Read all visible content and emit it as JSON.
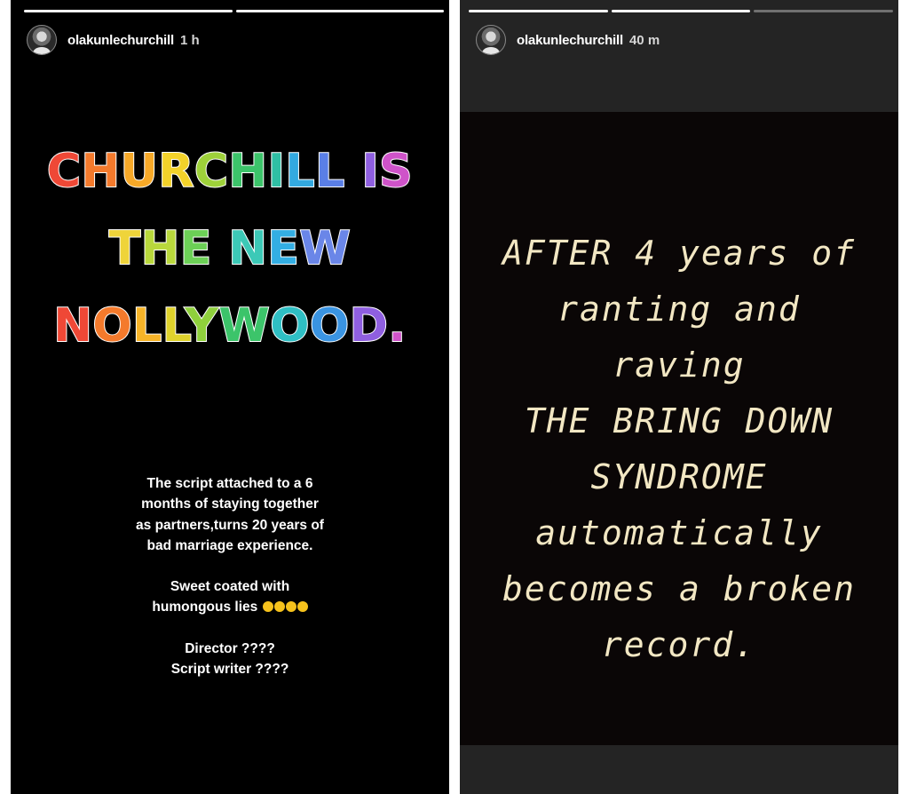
{
  "stories": [
    {
      "user": {
        "username": "olakunlechurchill",
        "time": "1 h"
      },
      "headline_lines": [
        {
          "chars": [
            {
              "c": "C",
              "color": "#ef4836"
            },
            {
              "c": "H",
              "color": "#f47a2c"
            },
            {
              "c": "U",
              "color": "#f7a928"
            },
            {
              "c": "R",
              "color": "#f3d22a"
            },
            {
              "c": "C",
              "color": "#9ed13a"
            },
            {
              "c": "H",
              "color": "#3cc46a"
            },
            {
              "c": "I",
              "color": "#2fbfa4"
            },
            {
              "c": "L",
              "color": "#33a9e0"
            },
            {
              "c": "L",
              "color": "#5a7fe6"
            },
            {
              "c": " ",
              "color": "#ffffff"
            },
            {
              "c": "I",
              "color": "#8f5fe0"
            },
            {
              "c": "S",
              "color": "#cf53c9"
            }
          ]
        },
        {
          "chars": [
            {
              "c": "T",
              "color": "#efd43a"
            },
            {
              "c": "H",
              "color": "#b9d83c"
            },
            {
              "c": "E",
              "color": "#6cd056"
            },
            {
              "c": " ",
              "color": "#ffffff"
            },
            {
              "c": "N",
              "color": "#3cc9b7"
            },
            {
              "c": "E",
              "color": "#33aee3"
            },
            {
              "c": "W",
              "color": "#6a86e8"
            }
          ]
        },
        {
          "chars": [
            {
              "c": "N",
              "color": "#ef4836"
            },
            {
              "c": "O",
              "color": "#f47a2c"
            },
            {
              "c": "L",
              "color": "#f7b428"
            },
            {
              "c": "L",
              "color": "#dfd22c"
            },
            {
              "c": "Y",
              "color": "#8fd03c"
            },
            {
              "c": "W",
              "color": "#3cc46a"
            },
            {
              "c": "O",
              "color": "#2fbfc4"
            },
            {
              "c": "O",
              "color": "#3a94e2"
            },
            {
              "c": "D",
              "color": "#8f5fe0"
            },
            {
              "c": ".",
              "color": "#cf53c9"
            }
          ]
        }
      ],
      "caption": {
        "paragraph1": "The script attached to a 6 months of staying together as partners,turns 20 years of bad marriage experience.",
        "paragraph2_line1": "Sweet coated with",
        "paragraph2_line2": "humongous lies",
        "emojis": [
          "joy-emoji",
          "joy-emoji",
          "rofl-emoji",
          "rofl-emoji"
        ],
        "line_director": "Director ????",
        "line_writer": "Script writer ????"
      }
    },
    {
      "user": {
        "username": "olakunlechurchill",
        "time": "40 m"
      },
      "typed_lines": [
        "AFTER 4 years of",
        "ranting and",
        "raving",
        "THE BRING DOWN",
        "SYNDROME",
        "automatically",
        "becomes a broken",
        "record."
      ]
    }
  ]
}
